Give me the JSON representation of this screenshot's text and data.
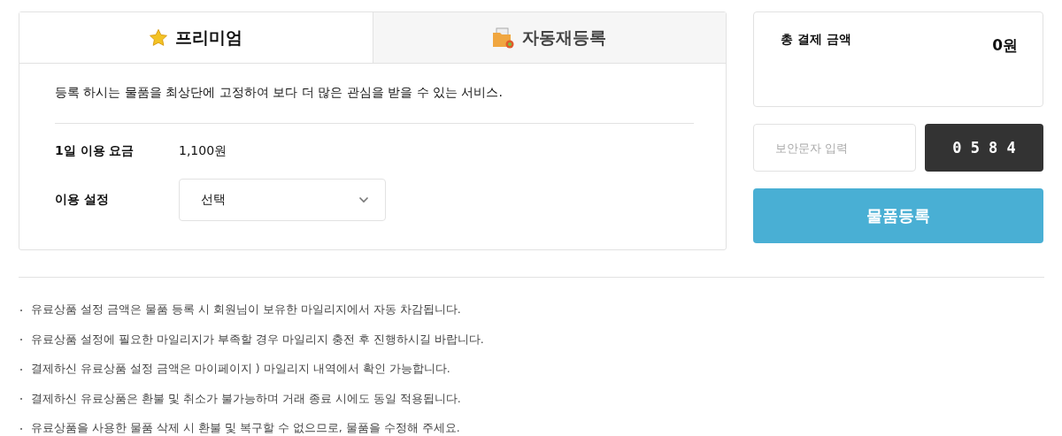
{
  "tabs": [
    {
      "label": "프리미엄",
      "selected": true,
      "kind": "star"
    },
    {
      "label": "자동재등록",
      "selected": false,
      "kind": "folder"
    }
  ],
  "description": "등록 하시는 물품을 최상단에 고정하여 보다 더 많은 관심을 받을 수 있는 서비스.",
  "fee": {
    "label": "1일 이용 요금",
    "value": "1,100원"
  },
  "usage": {
    "label": "이용 설정",
    "value": "선택"
  },
  "total": {
    "label": "총 결제 금액",
    "value": "0원"
  },
  "captcha": {
    "placeholder": "보안문자 입력",
    "code": "0 5 8 4"
  },
  "submit": "물품등록",
  "notes": [
    "유료상품 설정 금액은 물품 등록 시 회원님이 보유한 마일리지에서 자동 차감됩니다.",
    "유료상품 설정에 필요한 마일리지가 부족할 경우 마일리지 충전 후 진행하시길 바랍니다.",
    "결제하신 유료상품 설정 금액은 마이페이지 ) 마일리지 내역에서 확인 가능합니다.",
    "결제하신 유료상품은 환불 및 취소가 불가능하며 거래 종료 시에도 동일 적용됩니다.",
    "유료상품을 사용한 물품 삭제 시 환불 및 복구할 수 없으므로, 물품을 수정해 주세요."
  ]
}
